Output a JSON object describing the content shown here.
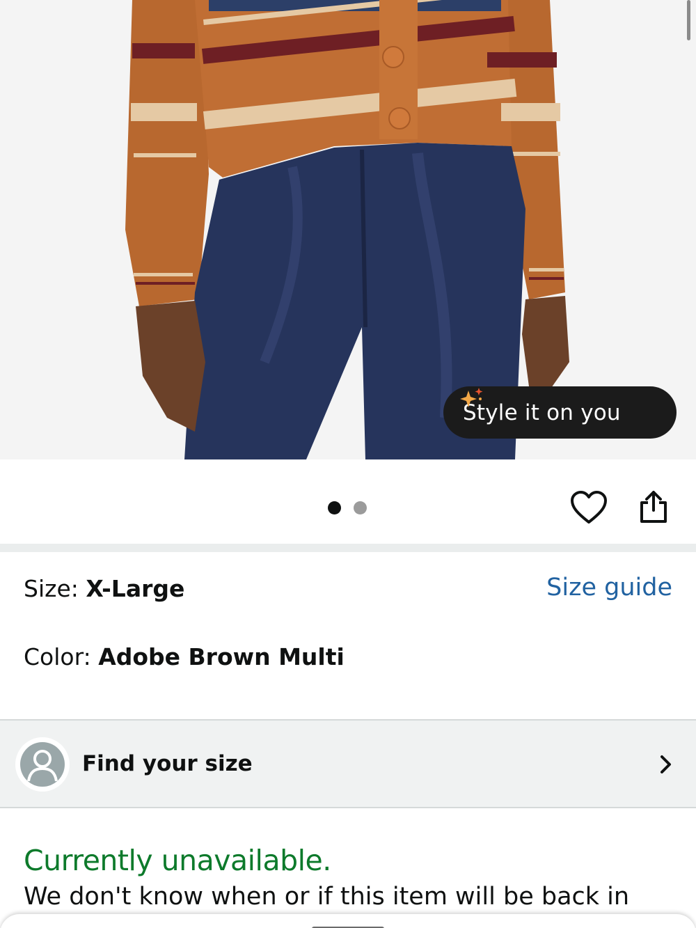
{
  "hero": {
    "style_button_label": "Style it on you",
    "sparkle_icon": "sparkle-icon",
    "image_count": 2,
    "active_image_index": 0
  },
  "actions": {
    "favorite_icon": "heart-icon",
    "share_icon": "share-icon"
  },
  "variations": {
    "size_key": "Size: ",
    "size_value": "X-Large",
    "size_guide_label": "Size guide",
    "color_key": "Color: ",
    "color_value": "Adobe Brown Multi"
  },
  "find_size": {
    "label": "Find your size",
    "avatar_icon": "person-icon",
    "chevron_icon": "chevron-right-icon"
  },
  "availability": {
    "status": "Currently unavailable.",
    "message": "We don't know when or if this item will be back in"
  },
  "colors": {
    "link": "#2162a1",
    "available_green": "#0d7a2b",
    "pill_bg": "#1b1b1b",
    "sparkle": "#f3a847"
  }
}
